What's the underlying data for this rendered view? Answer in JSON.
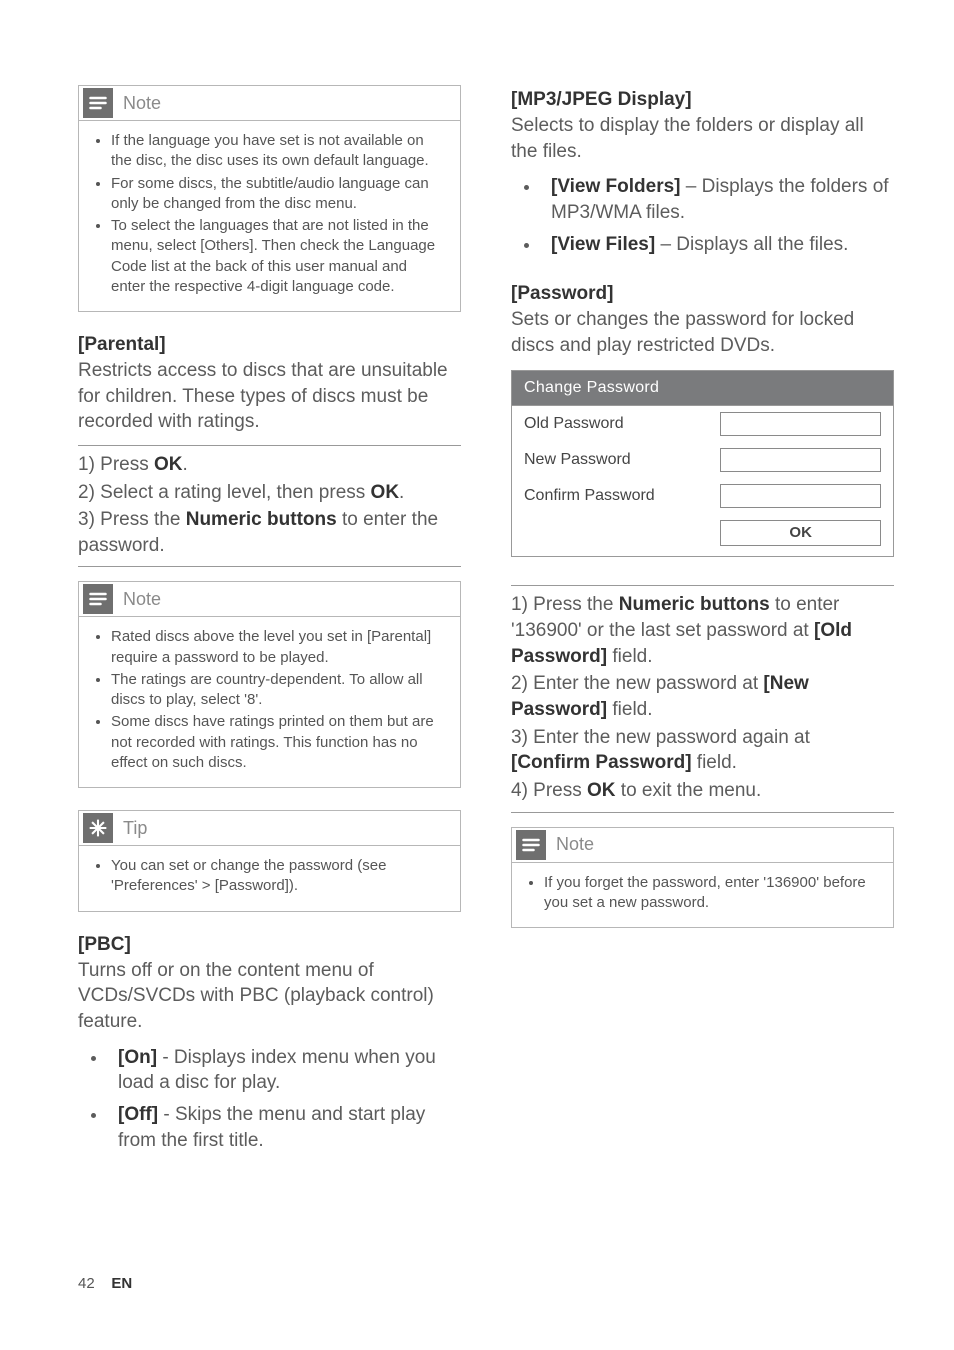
{
  "left": {
    "note1": {
      "label": "Note",
      "items": [
        "If the language you have set is not available on the disc, the disc uses its own default language.",
        "For some discs, the subtitle/audio language can only be changed from the disc menu.",
        "To select the languages that are not listed in the menu, select <b>[Others]</b>. Then check the Language Code list at the back of this user manual and enter the respective 4-digit language code."
      ]
    },
    "parental": {
      "head": "[Parental]",
      "desc": "Restricts access to discs that are unsuitable for children. These types of discs must be recorded with ratings.",
      "steps": [
        "1) Press <b>OK</b>.",
        "2) Select a rating level, then press <b>OK</b>.",
        "3) Press the <b>Numeric buttons</b> to enter the password."
      ]
    },
    "note2": {
      "label": "Note",
      "items": [
        "Rated discs above the level you set in <b>[Parental]</b> require a password to be played.",
        "The ratings are country-dependent. To allow all discs to play, select '<b>8</b>'.",
        "Some discs have ratings printed on them but are not recorded with ratings. This function has no effect on such discs."
      ]
    },
    "tip": {
      "label": "Tip",
      "items": [
        "You can set or change the password (see 'Preferences' > <b>[Password]</b>)."
      ]
    },
    "pbc": {
      "head": "[PBC]",
      "desc": "Turns off or on the content menu of VCDs/SVCDs with PBC (playback control) feature.",
      "opts": [
        "<b>[On]</b> - Displays index menu when you load a disc for play.",
        "<b>[Off]</b> - Skips the menu and start play from the first title."
      ]
    }
  },
  "right": {
    "mp3": {
      "head": "[MP3/JPEG Display]",
      "desc": "Selects to display the folders or display all the files.",
      "opts": [
        "<b>[View Folders]</b> – Displays the folders of MP3/WMA files.",
        "<b>[View Files]</b> – Displays all the files."
      ]
    },
    "password": {
      "head": "[Password]",
      "desc": "Sets or changes the password for locked discs and play restricted DVDs."
    },
    "table": {
      "title": "Change Password",
      "rows": [
        "Old Password",
        "New Password",
        "Confirm Password"
      ],
      "ok": "OK"
    },
    "pwsteps": [
      "1) Press the <b>Numeric buttons</b> to enter '136900' or the last set password at <b>[Old Password]</b> field.",
      "2) Enter the new password at <b>[New Password]</b> field.",
      "3) Enter the new password again at <b>[Confirm Password]</b> field.",
      "4) Press <b>OK</b> to exit the menu."
    ],
    "note": {
      "label": "Note",
      "items": [
        "If you forget the password, enter '136900' before you set a new password."
      ]
    }
  },
  "footer": {
    "page": "42",
    "lang": "EN"
  }
}
